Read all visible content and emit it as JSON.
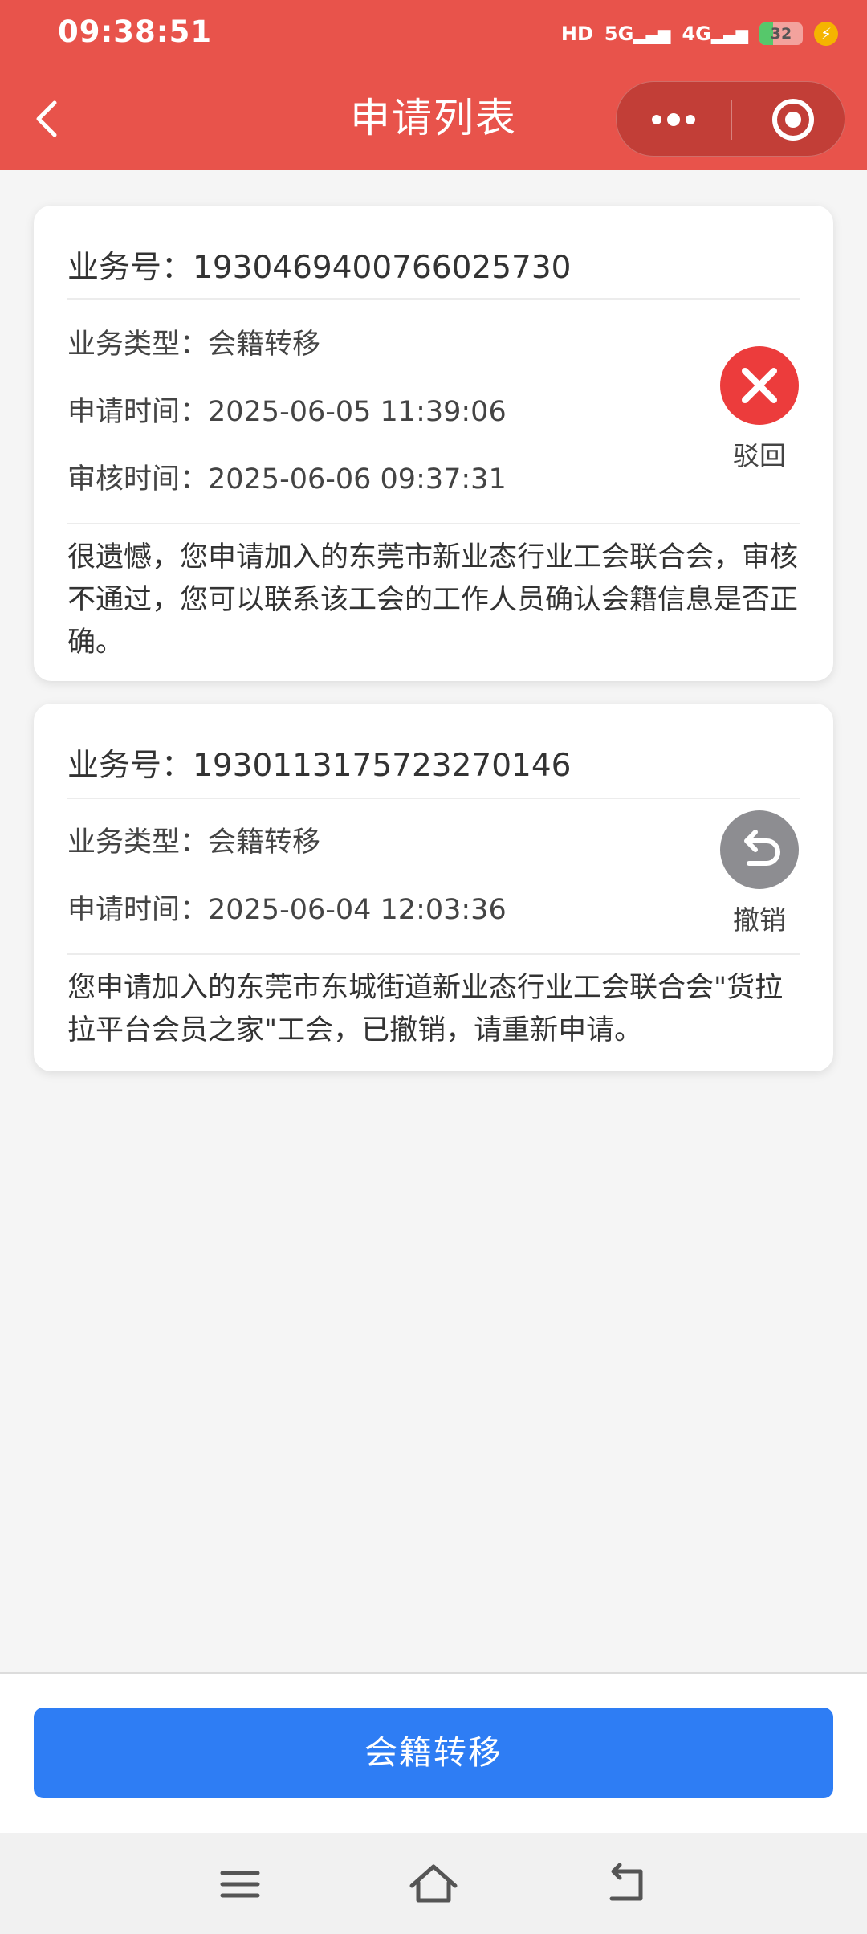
{
  "status_bar": {
    "time": "09:38:51",
    "hd": "HD",
    "network1": "5G",
    "network2": "4G",
    "battery": 32
  },
  "header": {
    "title": "申请列表",
    "back_icon": "chevron-left-icon",
    "more_icon": "more-dots-icon",
    "target_icon": "target-icon",
    "background_color": "#e8534b"
  },
  "applications": [
    {
      "biz_no": "业务号：1930469400766025730",
      "type": "业务类型：会籍转移",
      "apply_time": "申请时间：2025-06-05 11:39:06",
      "review_time": "审核时间：2025-06-06 09:37:31",
      "status_label": "驳回",
      "status_icon": "reject-x-icon",
      "status_color": "#ec3c3c",
      "message": "很遗憾，您申请加入的东莞市新业态行业工会联合会，审核不通过，您可以联系该工会的工作人员确认会籍信息是否正确。"
    },
    {
      "biz_no": "业务号：1930113175723270146",
      "type": "业务类型：会籍转移",
      "apply_time": "申请时间：2025-06-04 12:03:36",
      "status_label": "撤销",
      "status_icon": "undo-arrow-icon",
      "status_color": "#8d8d91",
      "message": "您申请加入的东莞市东城街道新业态行业工会联合会\"货拉拉平台会员之家\"工会，已撤销，请重新申请。"
    }
  ],
  "bottom": {
    "button_label": "会籍转移",
    "button_color": "#2e7df4"
  },
  "nav_bar": {
    "menu_icon": "menu-icon",
    "home_icon": "home-icon",
    "back_icon": "back-icon"
  }
}
